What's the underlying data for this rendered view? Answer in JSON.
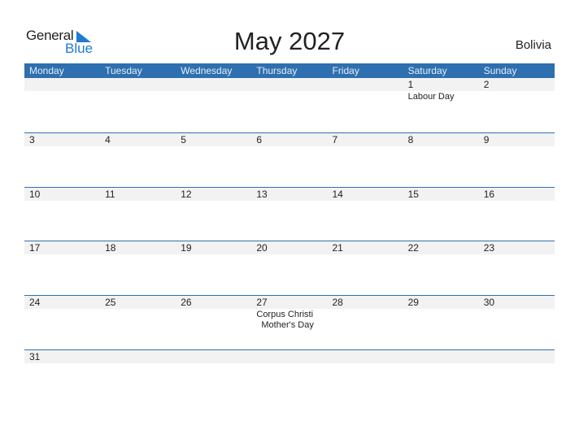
{
  "logo": {
    "word1": "General",
    "word2": "Blue"
  },
  "title": "May 2027",
  "country": "Bolivia",
  "colors": {
    "header_bg": "#2e6fb0",
    "date_row_bg": "#f2f2f2",
    "brand_blue": "#1f7bd1"
  },
  "weekdays": [
    "Monday",
    "Tuesday",
    "Wednesday",
    "Thursday",
    "Friday",
    "Saturday",
    "Sunday"
  ],
  "weeks": [
    {
      "days": [
        "",
        "",
        "",
        "",
        "",
        "1",
        "2"
      ],
      "events": [
        [],
        [],
        [],
        [],
        [],
        [
          "Labour Day"
        ],
        []
      ]
    },
    {
      "days": [
        "3",
        "4",
        "5",
        "6",
        "7",
        "8",
        "9"
      ],
      "events": [
        [],
        [],
        [],
        [],
        [],
        [],
        []
      ]
    },
    {
      "days": [
        "10",
        "11",
        "12",
        "13",
        "14",
        "15",
        "16"
      ],
      "events": [
        [],
        [],
        [],
        [],
        [],
        [],
        []
      ]
    },
    {
      "days": [
        "17",
        "18",
        "19",
        "20",
        "21",
        "22",
        "23"
      ],
      "events": [
        [],
        [],
        [],
        [],
        [],
        [],
        []
      ]
    },
    {
      "days": [
        "24",
        "25",
        "26",
        "27",
        "28",
        "29",
        "30"
      ],
      "events": [
        [],
        [],
        [],
        [
          "Corpus Christi",
          "Mother's Day"
        ],
        [],
        [],
        []
      ]
    },
    {
      "days": [
        "31",
        "",
        "",
        "",
        "",
        "",
        ""
      ],
      "events": [
        [],
        [],
        [],
        [],
        [],
        [],
        []
      ]
    }
  ]
}
